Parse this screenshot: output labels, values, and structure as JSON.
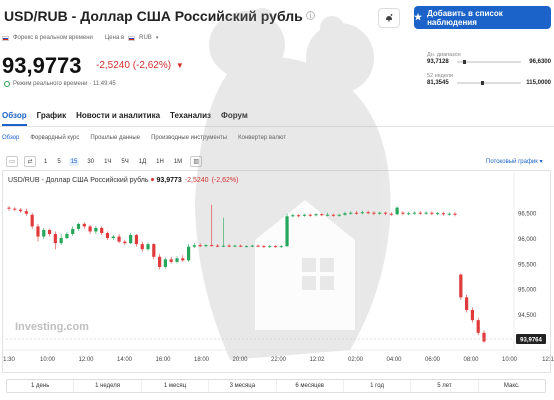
{
  "header": {
    "title": "USD/RUB - Доллар США Российский рубль",
    "info_icon": "info-icon",
    "watch_label": "Добавить в список наблюдения"
  },
  "meta": {
    "source": "Форекс в реальном времени",
    "currency_label": "Цена в",
    "currency": "RUB"
  },
  "quote": {
    "price": "93,9773",
    "change": "-2,5240",
    "change_pct": "(-2,62%)",
    "status": "Режим реального времени · 11:49:45"
  },
  "day_range": {
    "label": "Дн. диапазон",
    "low": "93,7128",
    "high": "96,6300",
    "position": 0.1
  },
  "week52_range": {
    "label": "52 недели",
    "low": "81,3545",
    "high": "115,0000",
    "position": 0.37
  },
  "tabs": [
    {
      "label": "Обзор",
      "active": true
    },
    {
      "label": "График"
    },
    {
      "label": "Новости и аналитика"
    },
    {
      "label": "Теханализ"
    },
    {
      "label": "Форум"
    }
  ],
  "subtabs": [
    {
      "label": "Обзор",
      "active": true
    },
    {
      "label": "Форвардный курс"
    },
    {
      "label": "Прошлые данные"
    },
    {
      "label": "Производные инструменты"
    },
    {
      "label": "Конвертер валют"
    }
  ],
  "timeframes": [
    "1",
    "5",
    "15",
    "30",
    "1Ч",
    "5Ч",
    "1Д",
    "1Н",
    "1М"
  ],
  "active_timeframe": "15",
  "stream_label": "Потоковый график",
  "chart_header": {
    "name": "USD/RUB - Доллар США Российский рубль",
    "price": "93,9773",
    "change": "-2,5240",
    "change_pct": "(-2,62%)"
  },
  "periods": [
    "1 день",
    "1 неделя",
    "1 месяц",
    "3 месяца",
    "6 месяцев",
    "1 год",
    "5 лет",
    "Макс."
  ],
  "chart_data": {
    "type": "candlestick",
    "x_ticks": [
      "1:30",
      "10:00",
      "12:00",
      "14:00",
      "16:00",
      "18:00",
      "20:00",
      "22:00",
      "12:02",
      "02:00",
      "04:00",
      "06:00",
      "08:00",
      "10:00",
      "12:1"
    ],
    "y_ticks": [
      96.5,
      96.0,
      95.5,
      95.0,
      94.5
    ],
    "ylim": [
      93.85,
      96.85
    ],
    "last_price_label": "93,9764",
    "last_price": 93.9764,
    "watermark": "Investing.com",
    "up_color": "#26a65b",
    "down_color": "#e03a3a",
    "candles": [
      {
        "o": 96.62,
        "c": 96.6,
        "h": 96.65,
        "l": 96.56
      },
      {
        "o": 96.6,
        "c": 96.58,
        "h": 96.63,
        "l": 96.55
      },
      {
        "o": 96.58,
        "c": 96.55,
        "h": 96.61,
        "l": 96.52
      },
      {
        "o": 96.55,
        "c": 96.5,
        "h": 96.6,
        "l": 96.46
      },
      {
        "o": 96.48,
        "c": 96.25,
        "h": 96.52,
        "l": 96.2
      },
      {
        "o": 96.25,
        "c": 96.05,
        "h": 96.3,
        "l": 95.95
      },
      {
        "o": 96.05,
        "c": 96.18,
        "h": 96.22,
        "l": 96.0
      },
      {
        "o": 96.18,
        "c": 96.1,
        "h": 96.2,
        "l": 96.05
      },
      {
        "o": 96.1,
        "c": 95.92,
        "h": 96.15,
        "l": 95.8
      },
      {
        "o": 95.92,
        "c": 96.02,
        "h": 96.1,
        "l": 95.88
      },
      {
        "o": 96.02,
        "c": 96.1,
        "h": 96.14,
        "l": 96.0
      },
      {
        "o": 96.1,
        "c": 96.2,
        "h": 96.25,
        "l": 96.06
      },
      {
        "o": 96.2,
        "c": 96.3,
        "h": 96.32,
        "l": 96.16
      },
      {
        "o": 96.3,
        "c": 96.25,
        "h": 96.33,
        "l": 96.2
      },
      {
        "o": 96.25,
        "c": 96.15,
        "h": 96.28,
        "l": 96.1
      },
      {
        "o": 96.15,
        "c": 96.22,
        "h": 96.26,
        "l": 96.1
      },
      {
        "o": 96.22,
        "c": 96.12,
        "h": 96.25,
        "l": 96.08
      },
      {
        "o": 96.12,
        "c": 96.02,
        "h": 96.15,
        "l": 95.98
      },
      {
        "o": 96.02,
        "c": 96.05,
        "h": 96.08,
        "l": 95.98
      },
      {
        "o": 96.05,
        "c": 95.95,
        "h": 96.1,
        "l": 95.92
      },
      {
        "o": 95.95,
        "c": 95.92,
        "h": 95.98,
        "l": 95.88
      },
      {
        "o": 95.92,
        "c": 96.08,
        "h": 96.12,
        "l": 95.9
      },
      {
        "o": 96.08,
        "c": 95.9,
        "h": 96.1,
        "l": 95.85
      },
      {
        "o": 95.9,
        "c": 95.8,
        "h": 95.95,
        "l": 95.75
      },
      {
        "o": 95.8,
        "c": 95.9,
        "h": 95.93,
        "l": 95.77
      },
      {
        "o": 95.9,
        "c": 95.65,
        "h": 95.92,
        "l": 95.6
      },
      {
        "o": 95.65,
        "c": 95.45,
        "h": 95.7,
        "l": 95.4
      },
      {
        "o": 95.45,
        "c": 95.6,
        "h": 95.63,
        "l": 95.42
      },
      {
        "o": 95.6,
        "c": 95.55,
        "h": 95.65,
        "l": 95.52
      },
      {
        "o": 95.55,
        "c": 95.62,
        "h": 95.66,
        "l": 95.52
      },
      {
        "o": 95.62,
        "c": 95.58,
        "h": 95.68,
        "l": 95.55
      },
      {
        "o": 95.58,
        "c": 95.85,
        "h": 95.9,
        "l": 95.55
      },
      {
        "o": 95.85,
        "c": 95.88,
        "h": 95.92,
        "l": 95.82
      },
      {
        "o": 95.88,
        "c": 95.86,
        "h": 95.92,
        "l": 95.84
      },
      {
        "o": 95.86,
        "c": 95.88,
        "h": 95.9,
        "l": 95.84
      },
      {
        "o": 95.88,
        "c": 95.87,
        "h": 96.68,
        "l": 95.85
      },
      {
        "o": 95.87,
        "c": 95.86,
        "h": 95.9,
        "l": 95.84
      },
      {
        "o": 95.86,
        "c": 95.87,
        "h": 96.42,
        "l": 95.84
      },
      {
        "o": 95.87,
        "c": 95.86,
        "h": 95.9,
        "l": 95.84
      },
      {
        "o": 95.86,
        "c": 95.87,
        "h": 95.89,
        "l": 95.84
      },
      {
        "o": 95.87,
        "c": 95.86,
        "h": 95.89,
        "l": 95.84
      },
      {
        "o": 95.86,
        "c": 95.86,
        "h": 95.88,
        "l": 95.84
      },
      {
        "o": 95.86,
        "c": 95.87,
        "h": 95.89,
        "l": 95.84
      },
      {
        "o": 95.87,
        "c": 95.86,
        "h": 95.89,
        "l": 95.84
      },
      {
        "o": 95.86,
        "c": 95.85,
        "h": 95.88,
        "l": 95.83
      },
      {
        "o": 95.85,
        "c": 95.86,
        "h": 95.88,
        "l": 95.83
      },
      {
        "o": 95.86,
        "c": 95.85,
        "h": 95.88,
        "l": 95.83
      },
      {
        "o": 95.85,
        "c": 95.86,
        "h": 95.88,
        "l": 95.83
      },
      {
        "o": 95.86,
        "c": 96.45,
        "h": 96.5,
        "l": 95.84
      },
      {
        "o": 96.45,
        "c": 96.47,
        "h": 96.5,
        "l": 96.43
      },
      {
        "o": 96.47,
        "c": 96.46,
        "h": 96.49,
        "l": 96.43
      },
      {
        "o": 96.46,
        "c": 96.48,
        "h": 96.5,
        "l": 96.44
      },
      {
        "o": 96.48,
        "c": 96.47,
        "h": 96.5,
        "l": 96.44
      },
      {
        "o": 96.47,
        "c": 96.49,
        "h": 96.51,
        "l": 96.45
      },
      {
        "o": 96.49,
        "c": 96.47,
        "h": 96.51,
        "l": 96.45
      },
      {
        "o": 96.47,
        "c": 96.48,
        "h": 96.52,
        "l": 96.45
      },
      {
        "o": 96.48,
        "c": 96.46,
        "h": 96.5,
        "l": 96.44
      },
      {
        "o": 96.46,
        "c": 96.48,
        "h": 96.5,
        "l": 96.44
      },
      {
        "o": 96.48,
        "c": 96.51,
        "h": 96.54,
        "l": 96.46
      },
      {
        "o": 96.51,
        "c": 96.52,
        "h": 96.55,
        "l": 96.48
      },
      {
        "o": 96.52,
        "c": 96.51,
        "h": 96.55,
        "l": 96.48
      },
      {
        "o": 96.51,
        "c": 96.53,
        "h": 96.56,
        "l": 96.49
      },
      {
        "o": 96.53,
        "c": 96.52,
        "h": 96.56,
        "l": 96.49
      },
      {
        "o": 96.52,
        "c": 96.5,
        "h": 96.55,
        "l": 96.47
      },
      {
        "o": 96.5,
        "c": 96.52,
        "h": 96.54,
        "l": 96.48
      },
      {
        "o": 96.52,
        "c": 96.5,
        "h": 96.54,
        "l": 96.47
      },
      {
        "o": 96.5,
        "c": 96.49,
        "h": 96.53,
        "l": 96.46
      },
      {
        "o": 96.49,
        "c": 96.62,
        "h": 96.64,
        "l": 96.47
      },
      {
        "o": 96.52,
        "c": 96.5,
        "h": 96.55,
        "l": 96.47
      },
      {
        "o": 96.5,
        "c": 96.51,
        "h": 96.54,
        "l": 96.47
      },
      {
        "o": 96.51,
        "c": 96.52,
        "h": 96.55,
        "l": 96.48
      },
      {
        "o": 96.52,
        "c": 96.51,
        "h": 96.55,
        "l": 96.48
      },
      {
        "o": 96.51,
        "c": 96.52,
        "h": 96.55,
        "l": 96.48
      },
      {
        "o": 96.52,
        "c": 96.5,
        "h": 96.55,
        "l": 96.47
      },
      {
        "o": 96.5,
        "c": 96.51,
        "h": 96.54,
        "l": 96.47
      },
      {
        "o": 96.51,
        "c": 96.49,
        "h": 96.54,
        "l": 96.46
      },
      {
        "o": 96.49,
        "c": 96.5,
        "h": 96.53,
        "l": 96.46
      },
      {
        "o": 96.5,
        "c": 96.48,
        "h": 96.53,
        "l": 96.45
      },
      {
        "o": 95.3,
        "c": 94.85,
        "h": 95.32,
        "l": 94.8
      },
      {
        "o": 94.85,
        "c": 94.6,
        "h": 94.9,
        "l": 94.55
      },
      {
        "o": 94.6,
        "c": 94.4,
        "h": 94.65,
        "l": 94.35
      },
      {
        "o": 94.4,
        "c": 94.15,
        "h": 94.45,
        "l": 94.1
      },
      {
        "o": 94.15,
        "c": 93.98,
        "h": 94.2,
        "l": 93.95
      }
    ]
  }
}
